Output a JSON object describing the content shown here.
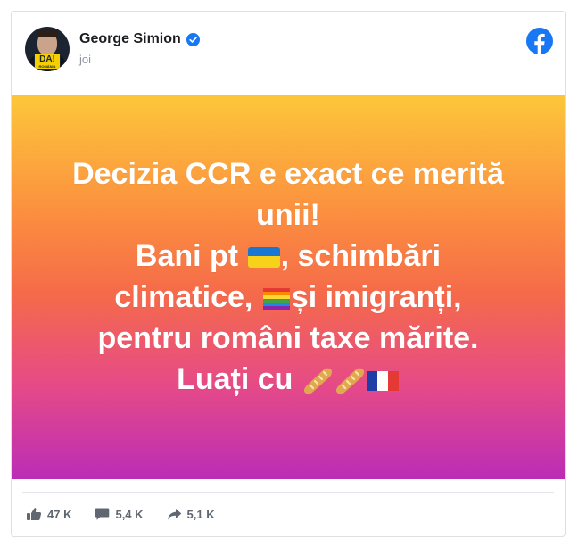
{
  "post": {
    "author": "George Simion",
    "timestamp": "joi",
    "verified": true,
    "platform_icon": "facebook-logo-icon",
    "text_lines": [
      "Decizia CCR e exact ce merită",
      "unii!",
      "Bani pt",
      ", schimbări",
      "climatice,",
      "și imigranți,",
      "pentru români taxe mărite.",
      "Luați cu"
    ],
    "emojis": [
      "ukraine-flag",
      "rainbow-flag",
      "baguette",
      "baguette",
      "france-flag"
    ],
    "background_gradient": [
      "#fdc73a",
      "#fb8b40",
      "#f56a4a",
      "#e64b86",
      "#bb2cb6"
    ]
  },
  "stats": {
    "likes": "47 K",
    "comments": "5,4 K",
    "shares": "5,1 K"
  },
  "colors": {
    "facebook_blue": "#1877f2",
    "text_muted": "#606770"
  }
}
